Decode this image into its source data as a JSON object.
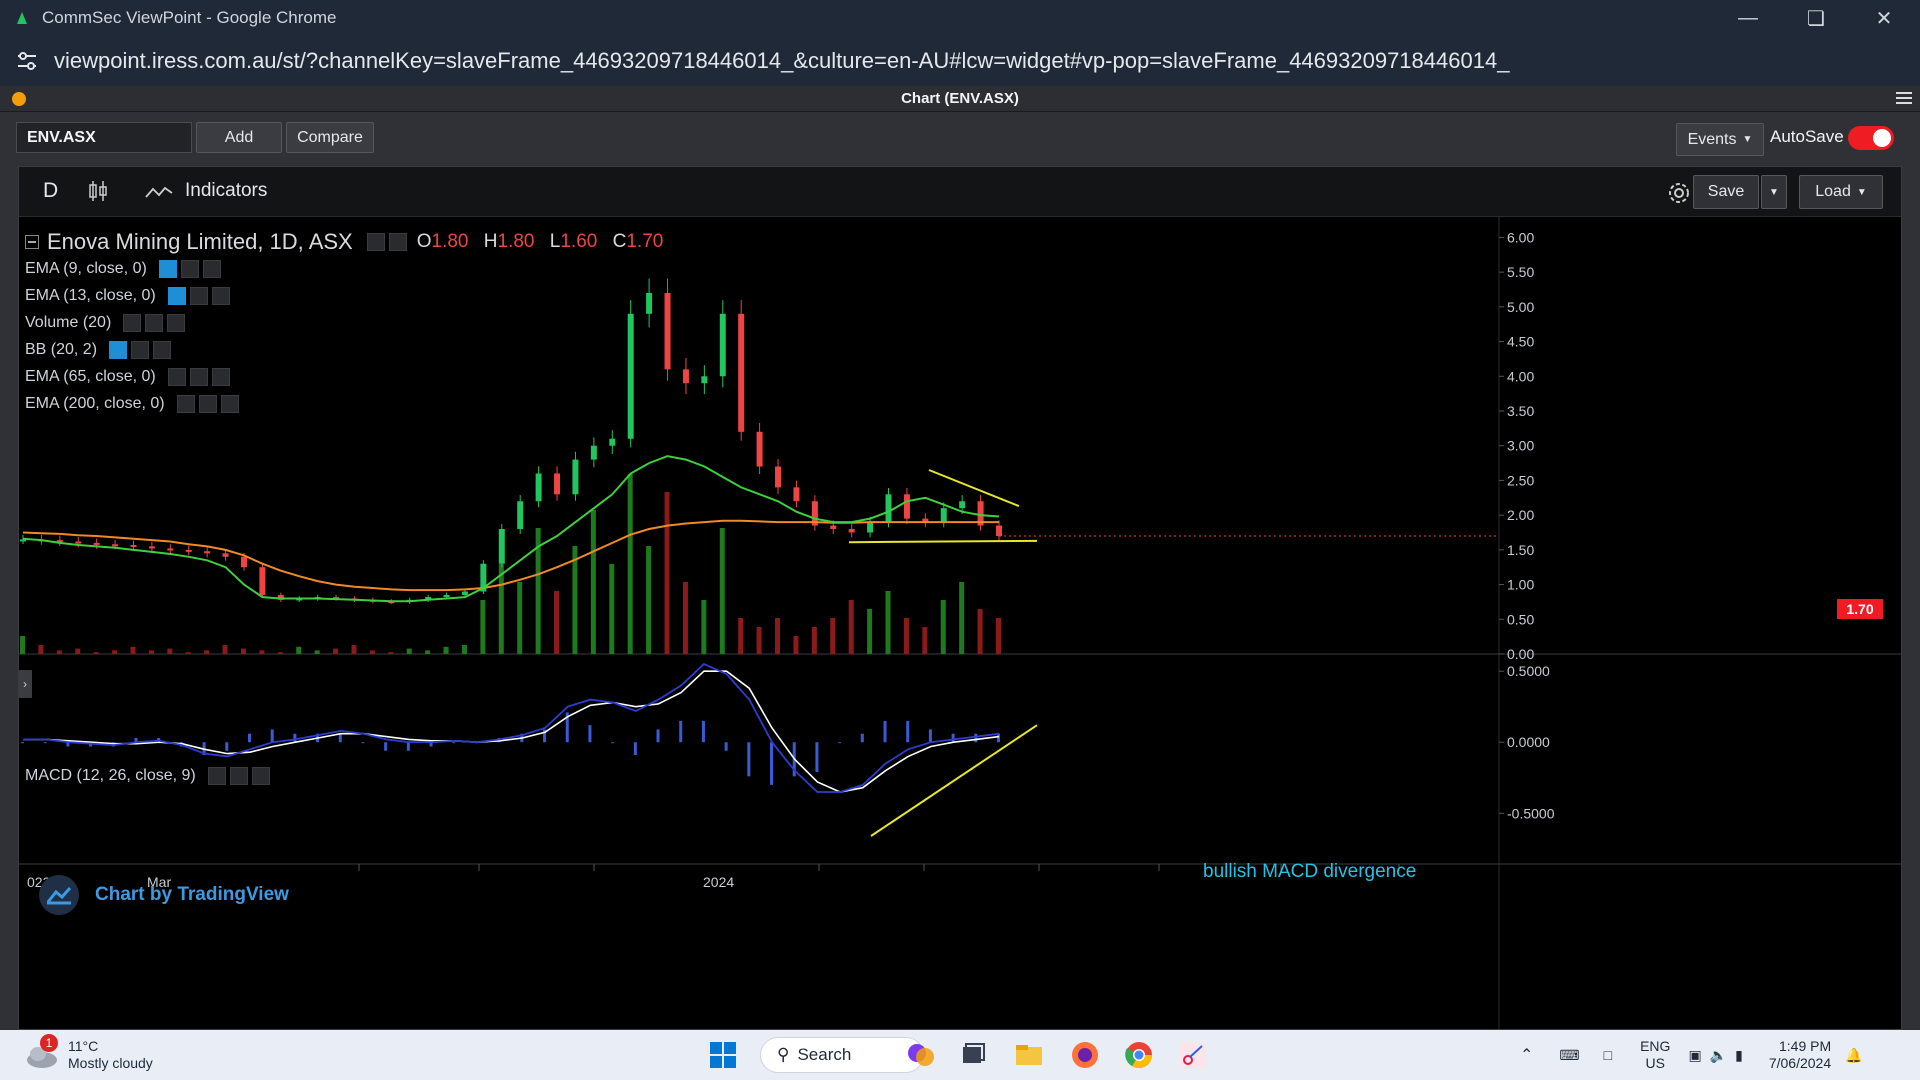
{
  "browser": {
    "title": "CommSec ViewPoint - Google Chrome",
    "url": "viewpoint.iress.com.au/st/?channelKey=slaveFrame_44693209718446014_&culture=en-AU#lcw=widget#vp-pop=slaveFrame_44693209718446014_"
  },
  "window": {
    "title": "Chart (ENV.ASX)"
  },
  "toolbar": {
    "symbol": "ENV.ASX",
    "add_label": "Add",
    "compare_label": "Compare",
    "events_label": "Events",
    "autosave_label": "AutoSave",
    "autosave_on": true
  },
  "chart_toolbar": {
    "interval": "D",
    "indicators_label": "Indicators",
    "save_label": "Save",
    "load_label": "Load"
  },
  "legend": {
    "title": "Enova Mining Limited, 1D, ASX",
    "o_label": "O",
    "o_value": "1.80",
    "h_label": "H",
    "h_value": "1.80",
    "l_label": "L",
    "l_value": "1.60",
    "c_label": "C",
    "c_value": "1.70",
    "studies": [
      "EMA (9, close, 0)",
      "EMA (13, close, 0)",
      "Volume (20)",
      "BB (20, 2)",
      "EMA (65, close, 0)",
      "EMA (200, close, 0)"
    ],
    "macd": "MACD (12, 26, close, 9)"
  },
  "chart_data": {
    "type": "line",
    "title": "Enova Mining Limited, 1D, ASX",
    "price_axis": {
      "ticks": [
        "6.00",
        "5.50",
        "5.00",
        "4.50",
        "4.00",
        "3.50",
        "3.00",
        "2.50",
        "2.00",
        "1.50",
        "1.00",
        "0.50",
        "0.00"
      ],
      "ylim": [
        0,
        6.15
      ]
    },
    "macd_axis": {
      "ticks": [
        "0.5000",
        "0.0000",
        "-0.5000"
      ],
      "ylim": [
        -0.85,
        0.6
      ]
    },
    "x_ticks": [
      "023",
      "Mar",
      "2024"
    ],
    "last_price": "1.70",
    "price_close": [
      1.65,
      1.64,
      1.62,
      1.6,
      1.58,
      1.57,
      1.55,
      1.52,
      1.5,
      1.48,
      1.45,
      1.4,
      1.25,
      0.85,
      0.78,
      0.8,
      0.82,
      0.8,
      0.78,
      0.76,
      0.75,
      0.78,
      0.82,
      0.85,
      0.9,
      1.3,
      1.8,
      2.2,
      2.6,
      2.3,
      2.8,
      3.0,
      3.1,
      4.9,
      5.2,
      4.1,
      3.9,
      4.0,
      4.9,
      3.2,
      2.7,
      2.4,
      2.2,
      1.85,
      1.8,
      1.75,
      1.9,
      2.3,
      1.95,
      1.9,
      2.1,
      2.2,
      1.85,
      1.7
    ],
    "ema_fast": [
      1.66,
      1.64,
      1.6,
      1.57,
      1.55,
      1.53,
      1.5,
      1.47,
      1.44,
      1.4,
      1.35,
      1.25,
      1.0,
      0.82,
      0.8,
      0.8,
      0.8,
      0.79,
      0.78,
      0.77,
      0.76,
      0.76,
      0.78,
      0.8,
      0.82,
      0.95,
      1.15,
      1.35,
      1.55,
      1.7,
      1.9,
      2.1,
      2.3,
      2.6,
      2.75,
      2.85,
      2.8,
      2.7,
      2.55,
      2.4,
      2.3,
      2.2,
      2.05,
      1.95,
      1.9,
      1.9,
      1.95,
      2.05,
      2.2,
      2.25,
      2.15,
      2.05,
      2.0,
      1.98
    ],
    "ema_slow": [
      1.75,
      1.74,
      1.73,
      1.71,
      1.7,
      1.68,
      1.66,
      1.64,
      1.62,
      1.58,
      1.55,
      1.5,
      1.42,
      1.3,
      1.2,
      1.12,
      1.05,
      1.0,
      0.97,
      0.95,
      0.93,
      0.92,
      0.92,
      0.92,
      0.93,
      0.95,
      1.0,
      1.07,
      1.15,
      1.25,
      1.36,
      1.48,
      1.6,
      1.72,
      1.8,
      1.85,
      1.88,
      1.9,
      1.92,
      1.92,
      1.91,
      1.9,
      1.9,
      1.9,
      1.89,
      1.89,
      1.9,
      1.9,
      1.9,
      1.9,
      1.9,
      1.9,
      1.9,
      1.9
    ],
    "volume": [
      0.1,
      0.05,
      0.02,
      0.03,
      0.01,
      0.02,
      0.04,
      0.02,
      0.03,
      0.01,
      0.02,
      0.05,
      0.03,
      0.02,
      0.01,
      0.04,
      0.02,
      0.03,
      0.05,
      0.02,
      0.01,
      0.03,
      0.02,
      0.04,
      0.05,
      0.3,
      0.5,
      0.4,
      0.7,
      0.35,
      0.6,
      0.8,
      0.5,
      1.0,
      0.6,
      0.9,
      0.4,
      0.3,
      0.7,
      0.2,
      0.15,
      0.2,
      0.1,
      0.15,
      0.2,
      0.3,
      0.25,
      0.35,
      0.2,
      0.15,
      0.3,
      0.4,
      0.25,
      0.2
    ],
    "macd_line": [
      0.02,
      0.02,
      0.0,
      -0.01,
      -0.02,
      0.0,
      0.01,
      -0.02,
      -0.08,
      -0.1,
      -0.05,
      0.0,
      0.02,
      0.05,
      0.08,
      0.06,
      0.02,
      0.0,
      0.0,
      0.01,
      0.0,
      0.02,
      0.05,
      0.1,
      0.25,
      0.3,
      0.28,
      0.22,
      0.3,
      0.4,
      0.55,
      0.48,
      0.3,
      0.0,
      -0.2,
      -0.35,
      -0.35,
      -0.3,
      -0.15,
      -0.05,
      0.0,
      0.02,
      0.04,
      0.06
    ],
    "signal_line": [
      0.02,
      0.02,
      0.01,
      0.0,
      -0.01,
      -0.01,
      0.0,
      -0.01,
      -0.05,
      -0.08,
      -0.07,
      -0.03,
      0.0,
      0.03,
      0.06,
      0.06,
      0.04,
      0.02,
      0.01,
      0.01,
      0.0,
      0.01,
      0.03,
      0.07,
      0.18,
      0.26,
      0.28,
      0.25,
      0.27,
      0.35,
      0.5,
      0.5,
      0.38,
      0.1,
      -0.12,
      -0.28,
      -0.35,
      -0.32,
      -0.2,
      -0.1,
      -0.03,
      0.0,
      0.02,
      0.04
    ],
    "annotation": "bullish MACD divergence"
  },
  "watermark": "Chart by TradingView",
  "taskbar": {
    "weather_temp": "11°C",
    "weather_desc": "Mostly cloudy",
    "weather_badge": "1",
    "search_label": "Search",
    "lang": "ENG",
    "region": "US",
    "time": "1:49 PM",
    "date": "7/06/2024"
  }
}
